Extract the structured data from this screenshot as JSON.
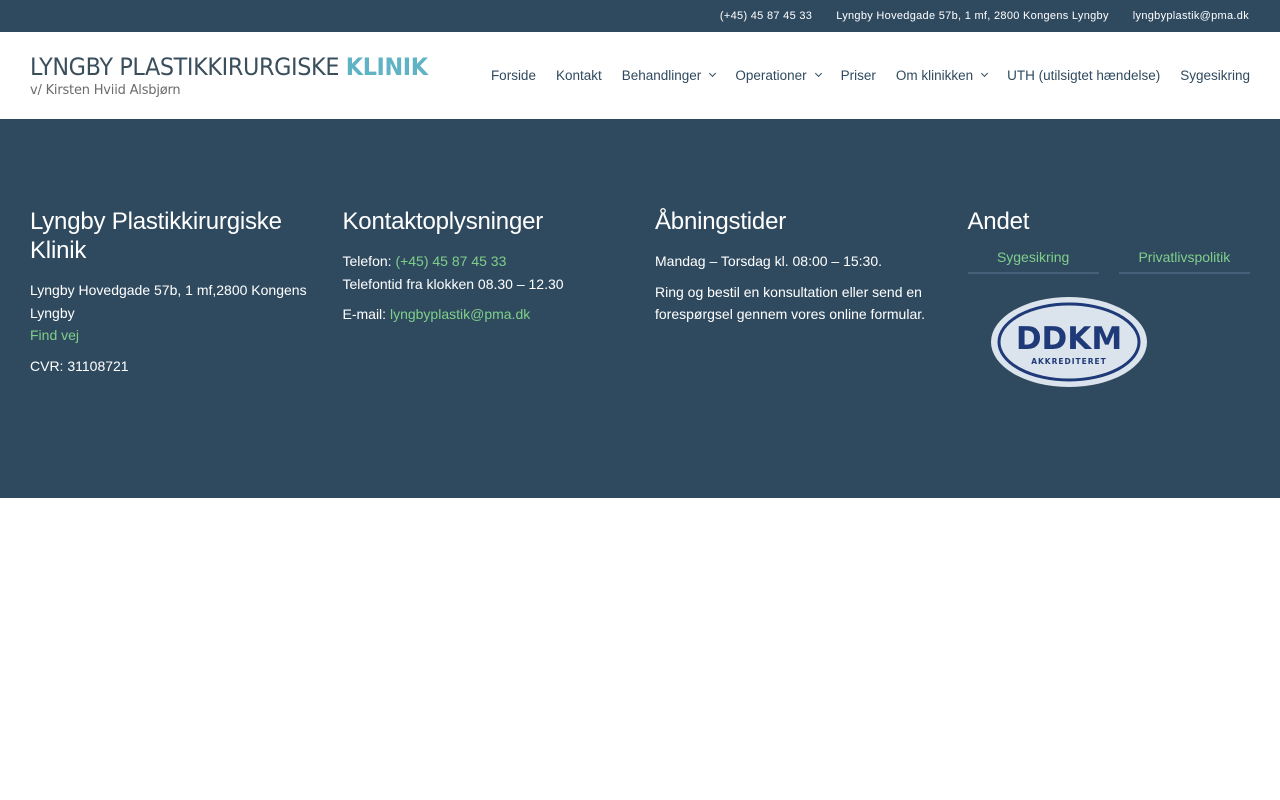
{
  "topbar": {
    "phone": "(+45) 45 87 45 33",
    "address": "Lyngby Hovedgade 57b, 1 mf, 2800 Kongens Lyngby",
    "email": "lyngbyplastik@pma.dk"
  },
  "logo": {
    "main": "LYNGBY PLASTIKKIRURGISKE",
    "accent": "KLINIK",
    "sub": "v/ Kirsten Hviid Alsbjørn"
  },
  "nav": {
    "forside": "Forside",
    "kontakt": "Kontakt",
    "behandlinger": "Behandlinger",
    "operationer": "Operationer",
    "priser": "Priser",
    "om_klinikken": "Om klinikken",
    "uth": "UTH (utilsigtet hændelse)",
    "sygesikring": "Sygesikring"
  },
  "footer": {
    "col1": {
      "title": "Lyngby Plastikkirurgiske Klinik",
      "address": "Lyngby Hovedgade 57b, 1 mf,2800 Kongens Lyngby",
      "find_vej": "Find vej",
      "cvr": "CVR: 31108721"
    },
    "col2": {
      "title": "Kontaktoplysninger",
      "phone_label": "Telefon: ",
      "phone": "(+45) 45 87 45 33",
      "phone_hours": "Telefontid fra klokken 08.30 – 12.30",
      "email_label": "E-mail: ",
      "email": "lyngbyplastik@pma.dk"
    },
    "col3": {
      "title": "Åbningstider",
      "hours": "Mandag – Torsdag kl. 08:00 – 15:30.",
      "info": "Ring og bestil en konsultation eller send en forespørgsel gennem vores online formular."
    },
    "col4": {
      "title": "Andet",
      "link1": "Sygesikring",
      "link2": "Privatlivspolitik",
      "badge_main": "DDKM",
      "badge_sub": "AKKREDITERET"
    }
  },
  "colors": {
    "primary": "#2f4a5f",
    "accent": "#5fb3c4",
    "link": "#7fcf8a",
    "badge_bg": "#dbe4ec",
    "badge_fg": "#1f3a78"
  }
}
